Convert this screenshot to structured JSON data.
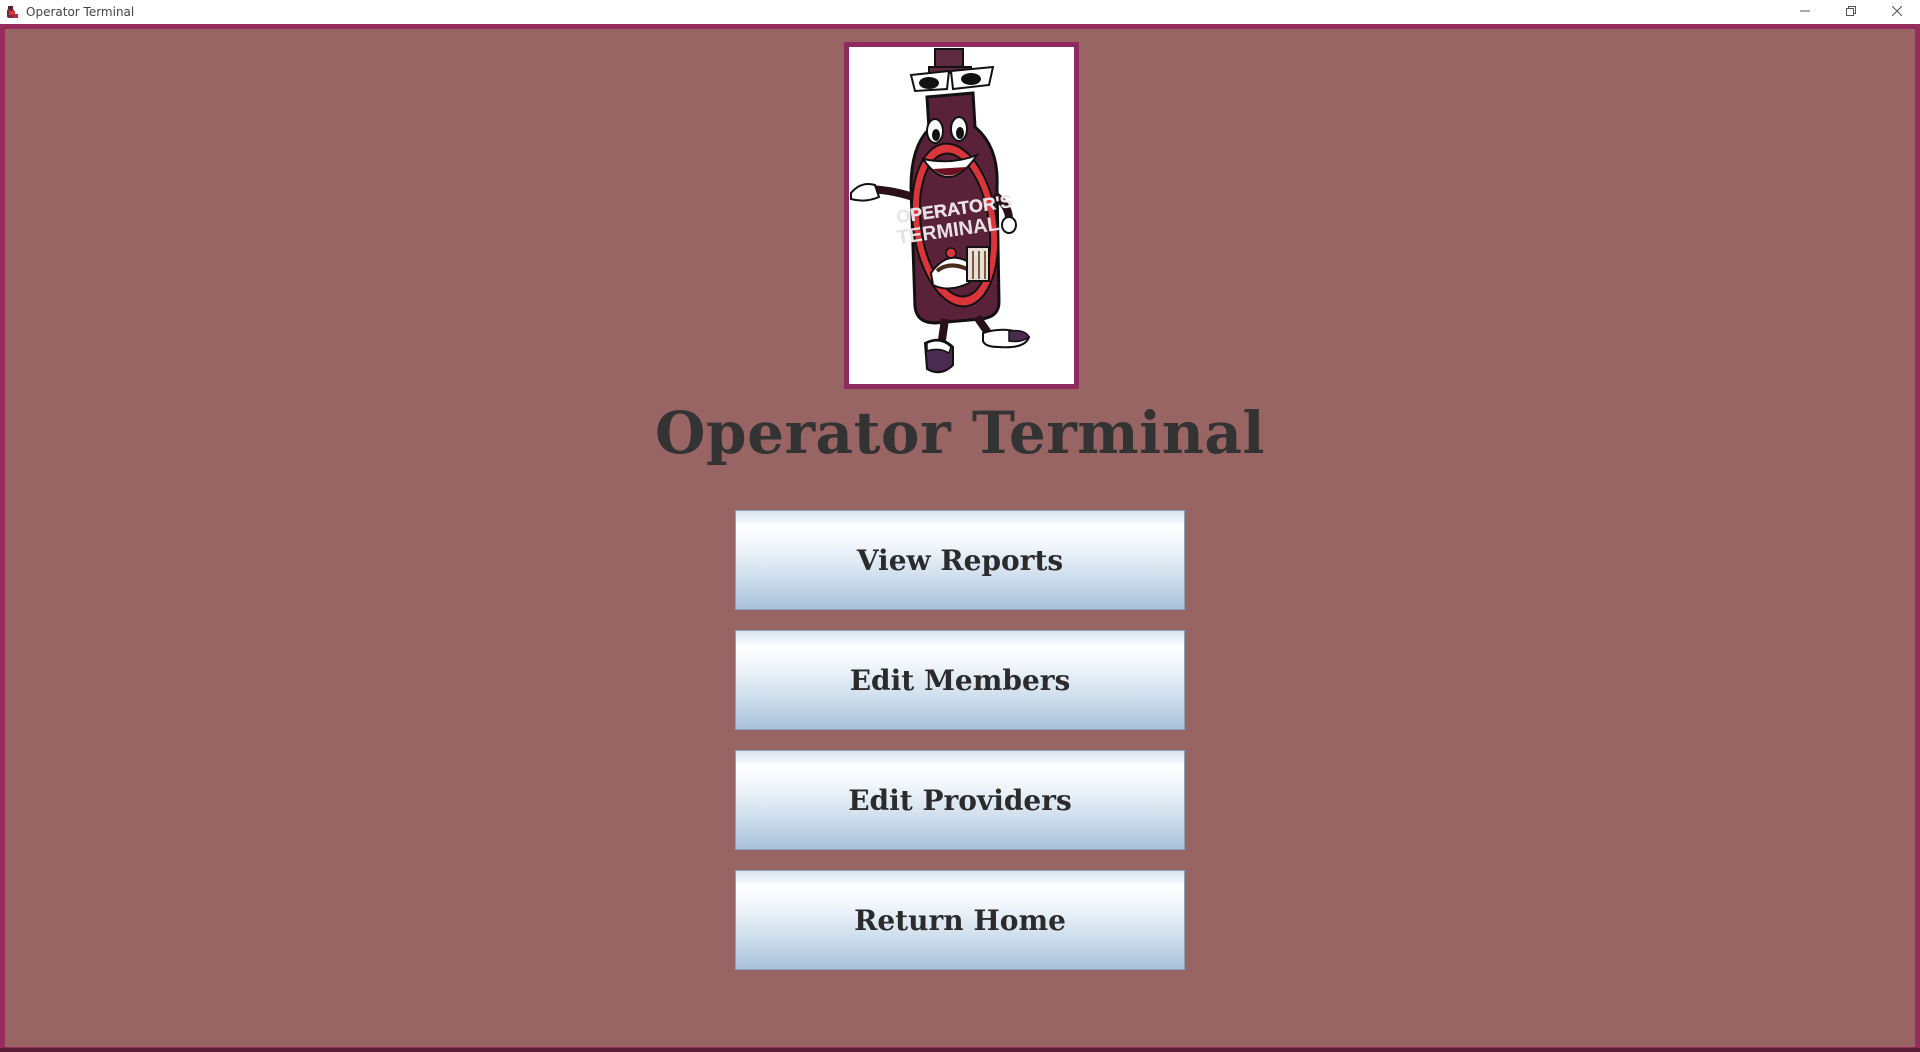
{
  "window": {
    "title": "Operator Terminal",
    "icon": "app-logo-icon",
    "controls": {
      "minimize_icon": "minimize-icon",
      "maximize_icon": "restore-icon",
      "close_icon": "close-icon"
    }
  },
  "logo": {
    "text_line1": "OPERATOR'S",
    "text_line2": "TERMINAL"
  },
  "header": {
    "title": "Operator Terminal"
  },
  "menu": {
    "view_reports": "View Reports",
    "edit_members": "Edit Members",
    "edit_providers": "Edit Providers",
    "return_home": "Return Home"
  },
  "colors": {
    "background": "#996564",
    "border": "#972d5d",
    "title_text": "#333333",
    "button_top": "#ffffff",
    "button_bottom": "#a9c2dc"
  }
}
